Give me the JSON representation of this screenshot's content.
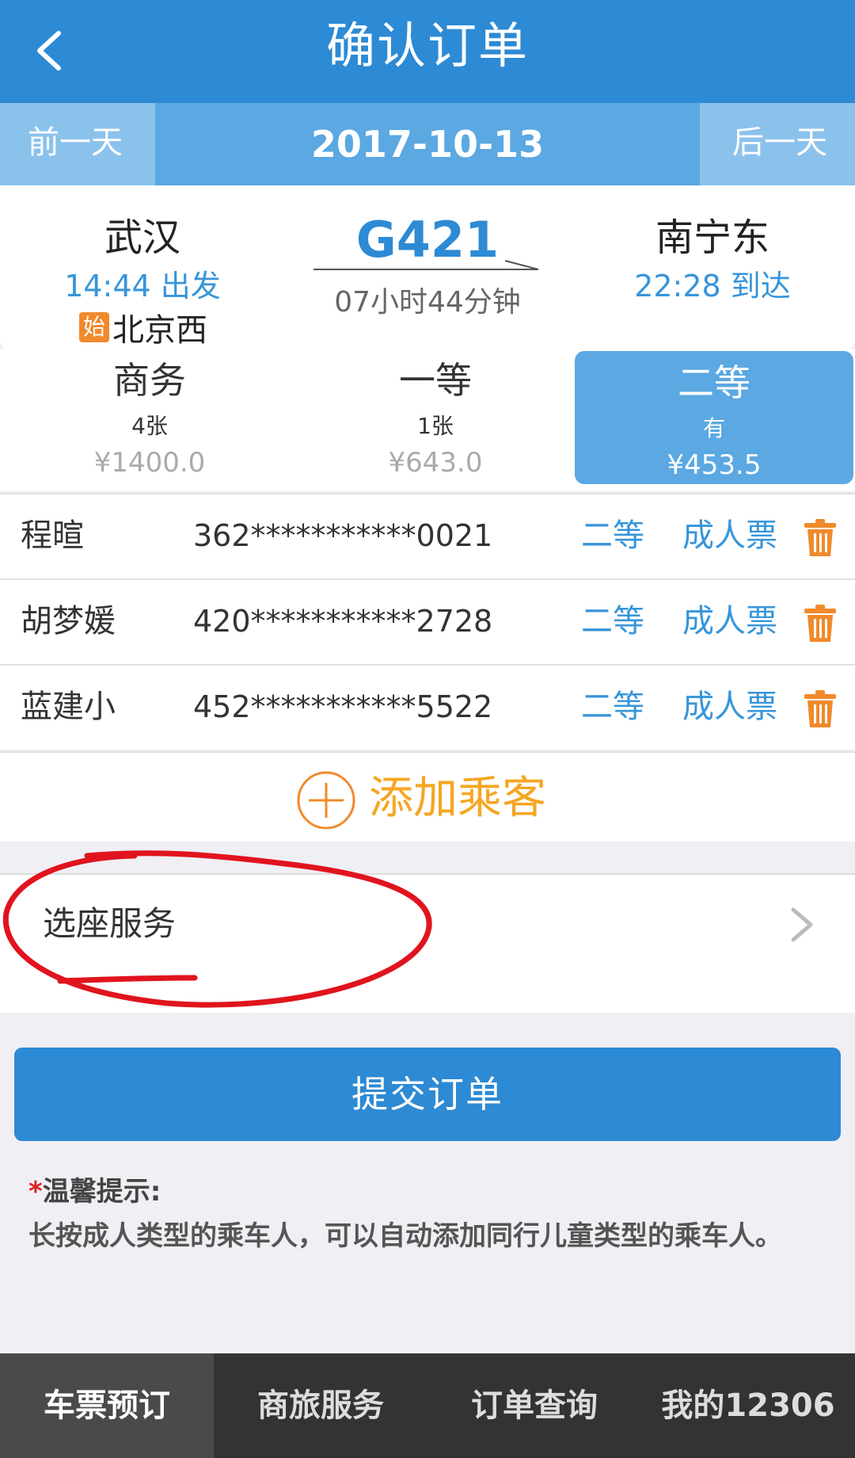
{
  "header": {
    "title": "确认订单"
  },
  "date_bar": {
    "prev_label": "前一天",
    "date": "2017-10-13",
    "next_label": "后一天"
  },
  "train": {
    "from_station": "武汉",
    "depart_time": "14:44 出发",
    "origin_badge": "始",
    "origin_station": "北京西",
    "train_no": "G421",
    "duration": "07小时44分钟",
    "to_station": "南宁东",
    "arrive_time": "22:28 到达"
  },
  "seat_classes": [
    {
      "name": "商务",
      "count": "4张",
      "price": "¥1400.0",
      "selected": false
    },
    {
      "name": "一等",
      "count": "1张",
      "price": "¥643.0",
      "selected": false
    },
    {
      "name": "二等",
      "count": "有",
      "price": "¥453.5",
      "selected": true
    }
  ],
  "passengers": [
    {
      "name": "程暄",
      "id": "362***********0021",
      "seat": "二等",
      "ticket_type": "成人票"
    },
    {
      "name": "胡梦媛",
      "id": "420***********2728",
      "seat": "二等",
      "ticket_type": "成人票"
    },
    {
      "name": "蓝建小",
      "id": "452***********5522",
      "seat": "二等",
      "ticket_type": "成人票"
    }
  ],
  "add_passenger_label": "添加乘客",
  "seat_service_label": "选座服务",
  "submit_label": "提交订单",
  "tip": {
    "star": "*",
    "title": "温馨提示:",
    "body": "长按成人类型的乘车人，可以自动添加同行儿童类型的乘车人。"
  },
  "tabbar": [
    {
      "label": "车票预订",
      "active": true
    },
    {
      "label": "商旅服务",
      "active": false
    },
    {
      "label": "订单查询",
      "active": false
    },
    {
      "label": "我的12306",
      "active": false
    }
  ],
  "colors": {
    "primary": "#2d8ad4",
    "accent_orange": "#f5a623",
    "annotation_red": "#e0141e"
  }
}
